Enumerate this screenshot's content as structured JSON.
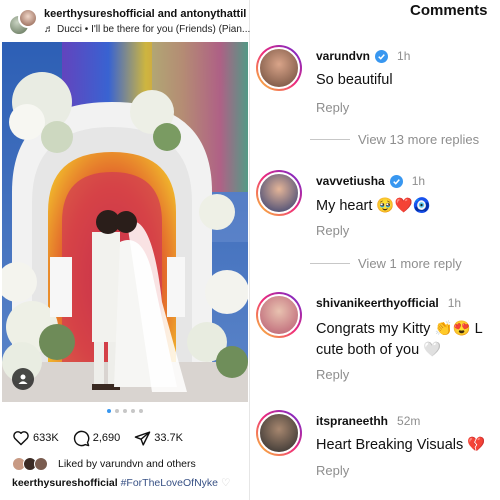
{
  "post": {
    "users": "keerthysureshofficial and antonythattil",
    "music": "Ducci • I'll be there for you (Friends) (Pian...",
    "likes": "633K",
    "comments": "2,690",
    "shares": "33.7K",
    "liked_by": "Liked by varundvn and others",
    "caption_user": "keerthysureshofficial",
    "caption_tag": "#ForTheLoveOfNyke",
    "carousel_count": 5,
    "carousel_active": 0
  },
  "comments_panel": {
    "title": "Comments",
    "comments": [
      {
        "user": "varundvn",
        "verified": true,
        "time": "1h",
        "text": "So beautiful",
        "reply": "Reply",
        "view_more": "View 13 more replies"
      },
      {
        "user": "vavvetiusha",
        "verified": true,
        "time": "1h",
        "text": "My heart 🥹❤️🧿",
        "reply": "Reply",
        "view_more": "View 1 more reply"
      },
      {
        "user": "shivanikeerthyofficial",
        "verified": false,
        "time": "1h",
        "text_line1": "Congrats my Kitty 👏😍 L",
        "text_line2": "cute both of you 🤍",
        "reply": "Reply"
      },
      {
        "user": "itspraneethh",
        "verified": false,
        "time": "52m",
        "text": "Heart Breaking Visuals 💔",
        "reply": "Reply"
      }
    ]
  },
  "colors": {
    "verified": "#3897f0",
    "link": "#385185",
    "muted": "#8e8e8e"
  }
}
